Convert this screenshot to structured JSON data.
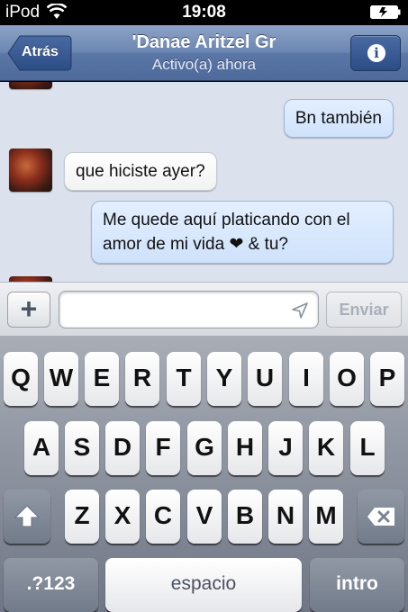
{
  "status_bar": {
    "carrier": "iPod",
    "time": "19:08"
  },
  "nav": {
    "back_label": "Atrás",
    "title": "'Danae Aritzel Gr",
    "subtitle": "Activo(a) ahora",
    "info_icon": "i"
  },
  "messages": [
    {
      "direction": "out",
      "text": "Bn también"
    },
    {
      "direction": "in",
      "text": "que hiciste ayer?"
    },
    {
      "direction": "out",
      "line1": "Me quede aquí platicando con el",
      "line2": "amor de mi vida ❤ & tu?"
    }
  ],
  "input_bar": {
    "plus_label": "+",
    "message_value": "",
    "send_label": "Enviar"
  },
  "keyboard": {
    "row1": [
      "Q",
      "W",
      "E",
      "R",
      "T",
      "Y",
      "U",
      "I",
      "O",
      "P"
    ],
    "row2": [
      "A",
      "S",
      "D",
      "F",
      "G",
      "H",
      "J",
      "K",
      "L"
    ],
    "row3": [
      "Z",
      "X",
      "C",
      "V",
      "B",
      "N",
      "M"
    ],
    "numbers_label": ".?123",
    "space_label": "espacio",
    "return_label": "intro"
  },
  "icons": {
    "wifi": "wifi-icon",
    "battery": "battery-icon",
    "back": "back-arrow-icon",
    "info": "info-icon",
    "location": "location-arrow-icon",
    "shift": "shift-arrow-icon",
    "delete": "delete-icon"
  },
  "colors": {
    "nav_bar": "#5b77a6",
    "outgoing_bubble": "#cfe2fb",
    "chat_background": "#dbe2ed"
  }
}
